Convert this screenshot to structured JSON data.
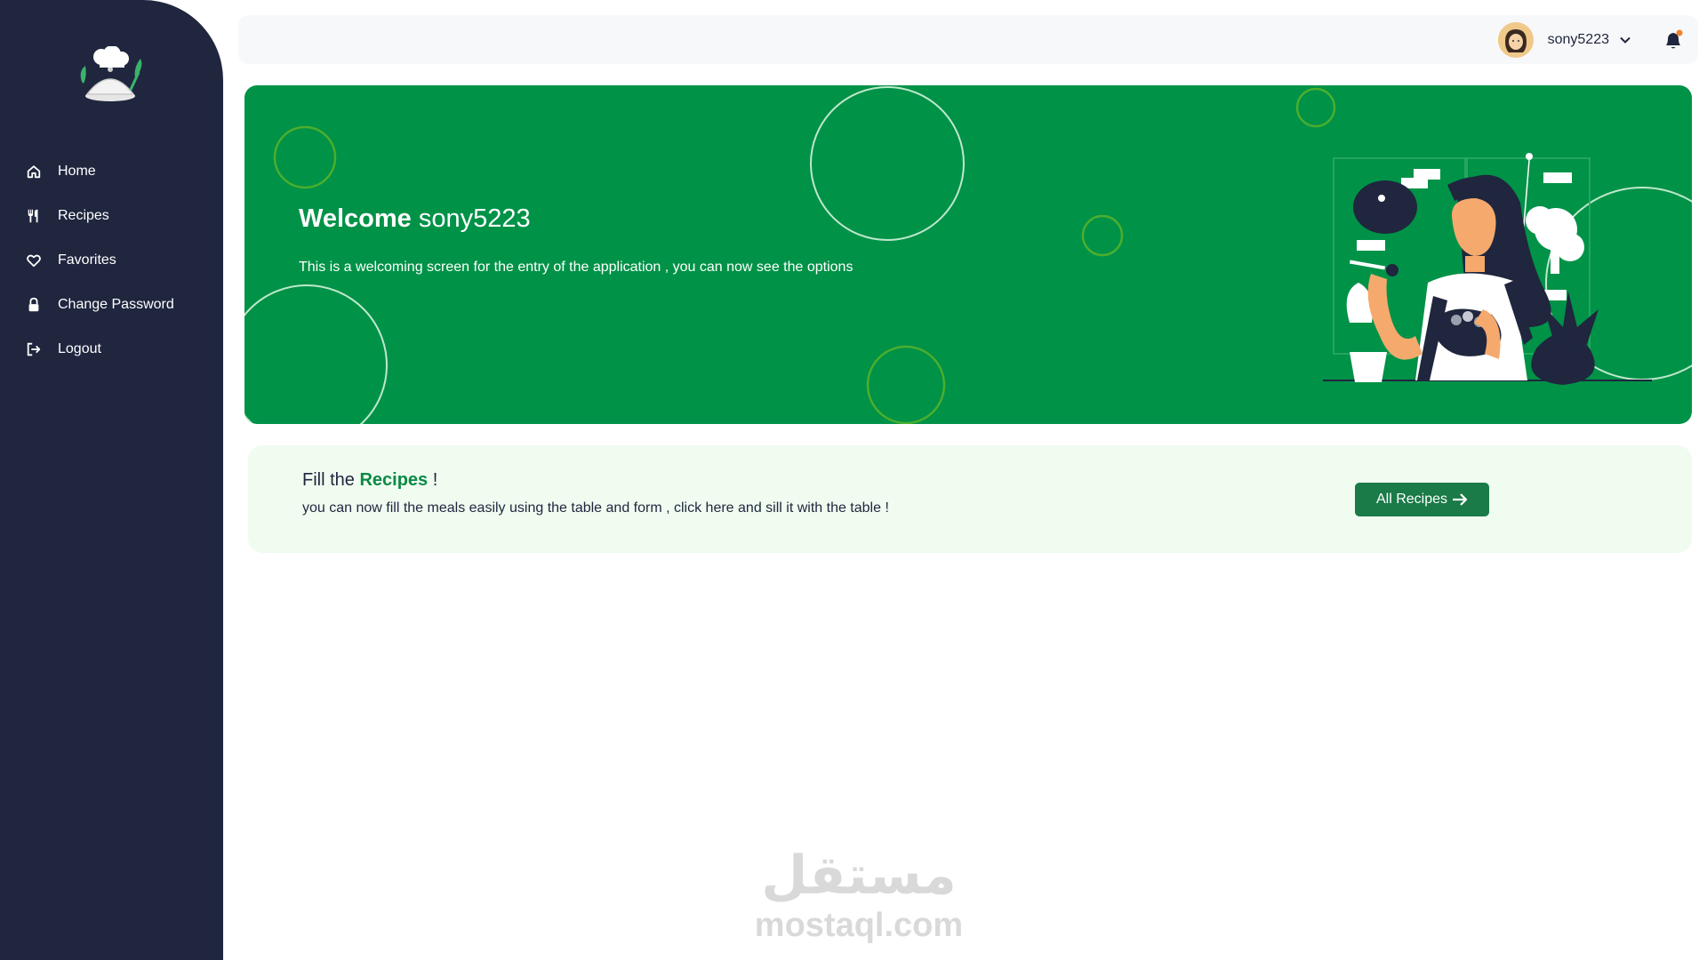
{
  "sidebar": {
    "items": [
      {
        "label": "Home",
        "icon": "home-icon"
      },
      {
        "label": "Recipes",
        "icon": "fork-knife-icon"
      },
      {
        "label": "Favorites",
        "icon": "heart-icon"
      },
      {
        "label": "Change Password",
        "icon": "lock-icon"
      },
      {
        "label": "Logout",
        "icon": "logout-icon"
      }
    ]
  },
  "topbar": {
    "username": "sony5223"
  },
  "banner": {
    "welcome_prefix": "Welcome",
    "welcome_name": "sony5223",
    "subtitle": "This is a welcoming screen for the entry of the application , you can now see the options"
  },
  "recipes_card": {
    "title_prefix": "Fill the",
    "title_accent": "Recipes",
    "title_suffix": " !",
    "subtitle": "you can now fill the meals easily using the table and form , click here and sill it with the table !",
    "button_label": "All Recipes"
  },
  "watermark": {
    "arabic": "مستقل",
    "latin": "mostaql.com"
  },
  "colors": {
    "sidebar_bg": "#1f263e",
    "banner_green": "#009247",
    "accent_green": "#0a8a45",
    "button_green": "#1a7a48",
    "card_bg": "#f0fcf0"
  }
}
